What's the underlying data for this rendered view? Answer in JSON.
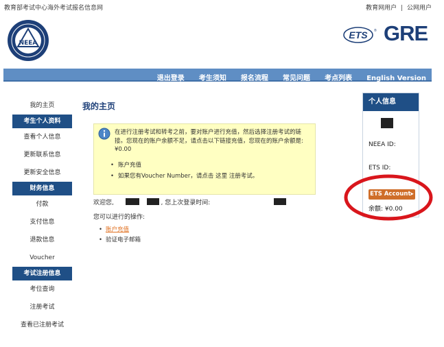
{
  "header": {
    "site_title": "教育部考试中心海外考试报名信息网",
    "top_links": [
      "教育网用户",
      "公网用户"
    ],
    "top_links_separator": "|",
    "neea_logo_text": "NEEA",
    "ets_logo_text": "ETS",
    "gre_logo_text": "GRE"
  },
  "nav": {
    "items": [
      "退出登录",
      "考生须知",
      "报名流程",
      "常见问题",
      "考点列表",
      "English Version"
    ]
  },
  "sidebar": {
    "items": [
      {
        "type": "link",
        "label": "我的主页"
      },
      {
        "type": "head",
        "label": "考生个人资料"
      },
      {
        "type": "link",
        "label": "查看个人信息"
      },
      {
        "type": "link",
        "label": "更新联系信息"
      },
      {
        "type": "link",
        "label": "更新安全信息"
      },
      {
        "type": "head",
        "label": "财务信息"
      },
      {
        "type": "link",
        "label": "付款"
      },
      {
        "type": "link",
        "label": "支付信息"
      },
      {
        "type": "link",
        "label": "退款信息"
      },
      {
        "type": "link",
        "label": "Voucher"
      },
      {
        "type": "head",
        "label": "考试注册信息"
      },
      {
        "type": "link",
        "label": "考位查询"
      },
      {
        "type": "link",
        "label": "注册考试"
      },
      {
        "type": "link",
        "label": "查看已注册考试"
      }
    ]
  },
  "main": {
    "page_title": "我的主页",
    "notice": {
      "text": "在进行注册考试和转考之前，要对账户进行充值，然后选择注册考试的链接。您现在的账户余额不足，请点击以下链接充值，您现在的账户余额是:",
      "balance": "¥0.00",
      "items": [
        "账户充值",
        "如果您有Voucher Number，请点击 这里 注册考试。"
      ]
    },
    "welcome_prefix": "欢迎您,",
    "welcome_middle": ", 您上次登录时间:",
    "ops_title": "您可以进行的操作:",
    "ops": [
      "账户充值",
      "验证电子邮箱"
    ]
  },
  "info_panel": {
    "title": "个人信息",
    "neea_label": "NEEA ID:",
    "ets_label": "ETS ID:",
    "ets_button": "ETS Account",
    "balance": "余额: ¥0.00"
  },
  "colors": {
    "nav_blue": "#5f8ec4",
    "dark_blue": "#1f4f86",
    "notice_yellow": "#ffffc2",
    "orange": "#cf6e2a",
    "annotation_red": "#d9161c"
  }
}
